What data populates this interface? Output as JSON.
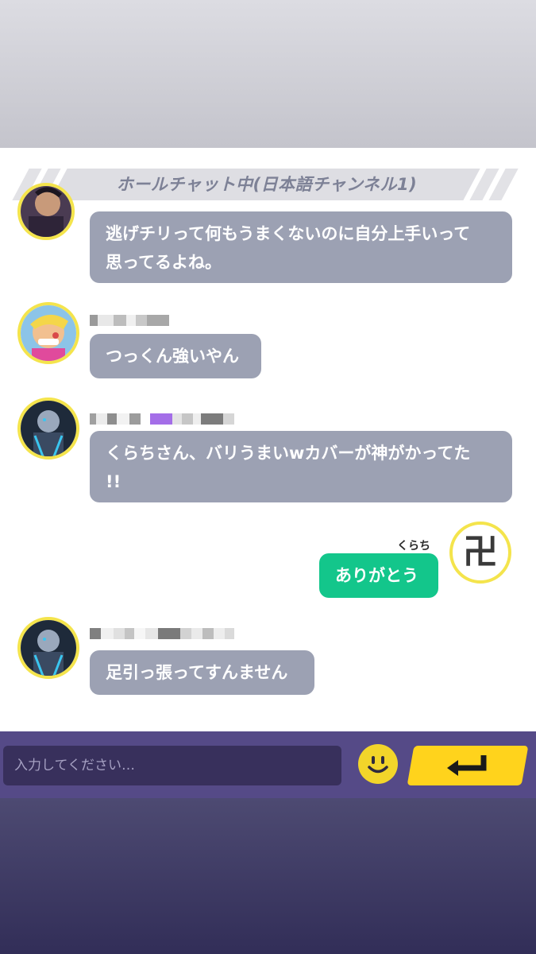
{
  "channel": {
    "title": "ホールチャット中(日本語チャンネル1)"
  },
  "messages": [
    {
      "text_line1": "逃げチリって何もうまくないのに自分上手いって",
      "text_line2": "思ってるよね。"
    },
    {
      "text": "つっくん強いやん"
    },
    {
      "text_line1": "くらちさん、バリうまいwカバーが神がかってた",
      "text_line2": "!!"
    },
    {
      "sender": "くらち",
      "text": "ありがとう",
      "avatar_glyph": "卍"
    },
    {
      "text": "足引っ張ってすんません"
    }
  ],
  "input": {
    "placeholder": "入力してください…"
  },
  "icons": {
    "emoji": "smiley-icon",
    "send": "enter-arrow-icon"
  },
  "colors": {
    "bubble_other": "#9ca1b3",
    "bubble_mine": "#13c68b",
    "avatar_ring": "#f4e44c",
    "input_bar": "#554a87",
    "send_button": "#ffd31c"
  }
}
